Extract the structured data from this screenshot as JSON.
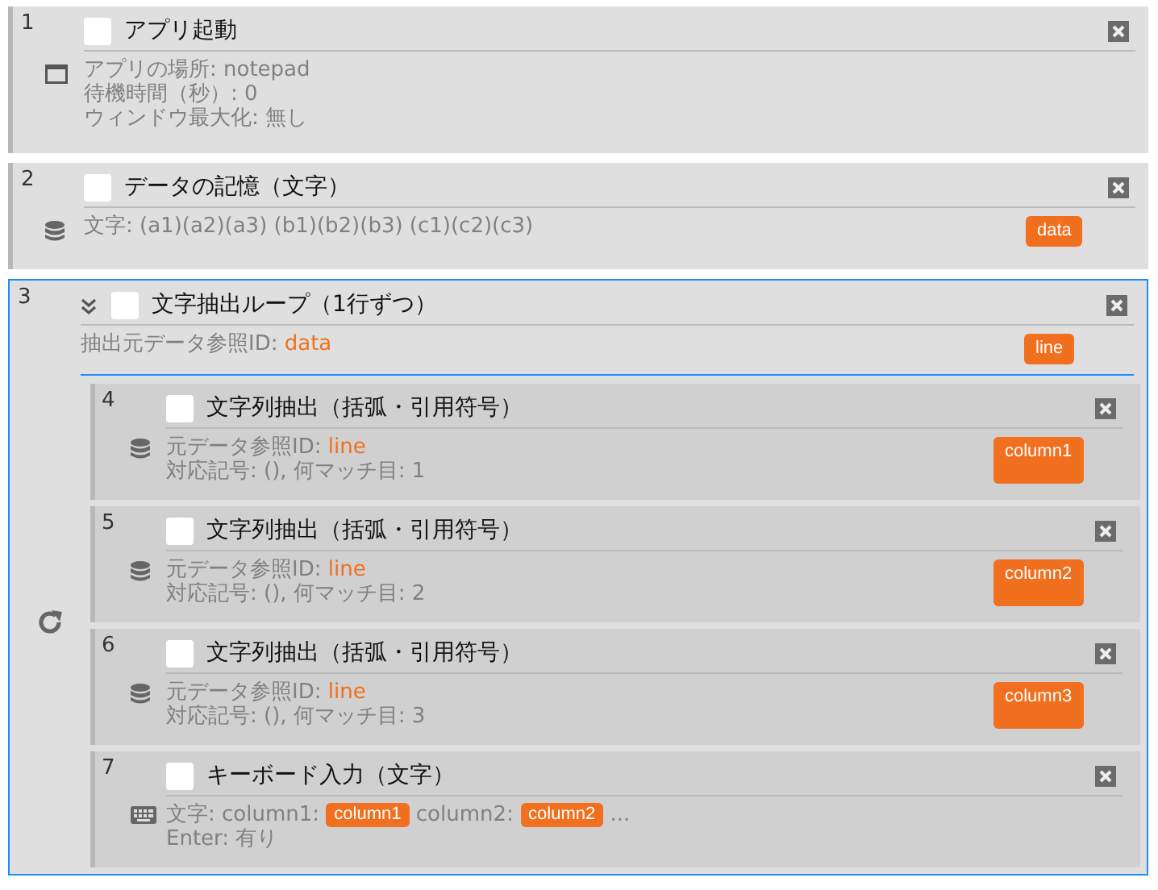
{
  "blocks": [
    {
      "number": "1",
      "kind": "window",
      "title": "アプリ起動",
      "checked": false,
      "selected": false,
      "lines": [
        [
          {
            "kind": "text",
            "text": "アプリの場所: notepad"
          }
        ],
        [
          {
            "kind": "text",
            "text": "待機時間（秒）: 0"
          }
        ],
        [
          {
            "kind": "text",
            "text": "ウィンドウ最大化: 無し"
          }
        ]
      ]
    },
    {
      "number": "2",
      "kind": "database",
      "title": "データの記憶（文字）",
      "checked": false,
      "selected": false,
      "output": "data",
      "lines": [
        [
          {
            "kind": "text",
            "text": "文字: (a1)(a2)(a3) (b1)(b2)(b3) (c1)(c2)(c3)"
          }
        ]
      ]
    },
    {
      "number": "3",
      "kind": "loop",
      "title": "文字抽出ループ（1行ずつ）",
      "checked": false,
      "selected": true,
      "expanded": true,
      "output": "line",
      "lines": [
        [
          {
            "kind": "text",
            "text": "抽出元データ参照ID: "
          },
          {
            "kind": "ref",
            "text": "data"
          }
        ]
      ],
      "children": [
        {
          "number": "4",
          "kind": "database",
          "title": "文字列抽出（括弧・引用符号）",
          "checked": false,
          "output": "column1",
          "lines": [
            [
              {
                "kind": "text",
                "text": "元データ参照ID: "
              },
              {
                "kind": "ref",
                "text": "line"
              }
            ],
            [
              {
                "kind": "text",
                "text": "対応記号: (), 何マッチ目: 1"
              }
            ]
          ]
        },
        {
          "number": "5",
          "kind": "database",
          "title": "文字列抽出（括弧・引用符号）",
          "checked": false,
          "output": "column2",
          "lines": [
            [
              {
                "kind": "text",
                "text": "元データ参照ID: "
              },
              {
                "kind": "ref",
                "text": "line"
              }
            ],
            [
              {
                "kind": "text",
                "text": "対応記号: (), 何マッチ目: 2"
              }
            ]
          ]
        },
        {
          "number": "6",
          "kind": "database",
          "title": "文字列抽出（括弧・引用符号）",
          "checked": false,
          "output": "column3",
          "lines": [
            [
              {
                "kind": "text",
                "text": "元データ参照ID: "
              },
              {
                "kind": "ref",
                "text": "line"
              }
            ],
            [
              {
                "kind": "text",
                "text": "対応記号: (), 何マッチ目: 3"
              }
            ]
          ]
        },
        {
          "number": "7",
          "kind": "keyboard",
          "title": "キーボード入力（文字）",
          "checked": false,
          "lines": [
            [
              {
                "kind": "text",
                "text": "文字: column1: "
              },
              {
                "kind": "tag",
                "text": "column1"
              },
              {
                "kind": "text",
                "text": " column2: "
              },
              {
                "kind": "tag",
                "text": "column2"
              },
              {
                "kind": "text",
                "text": " ..."
              }
            ],
            [
              {
                "kind": "text",
                "text": "Enter: 有り"
              }
            ]
          ]
        }
      ]
    }
  ]
}
